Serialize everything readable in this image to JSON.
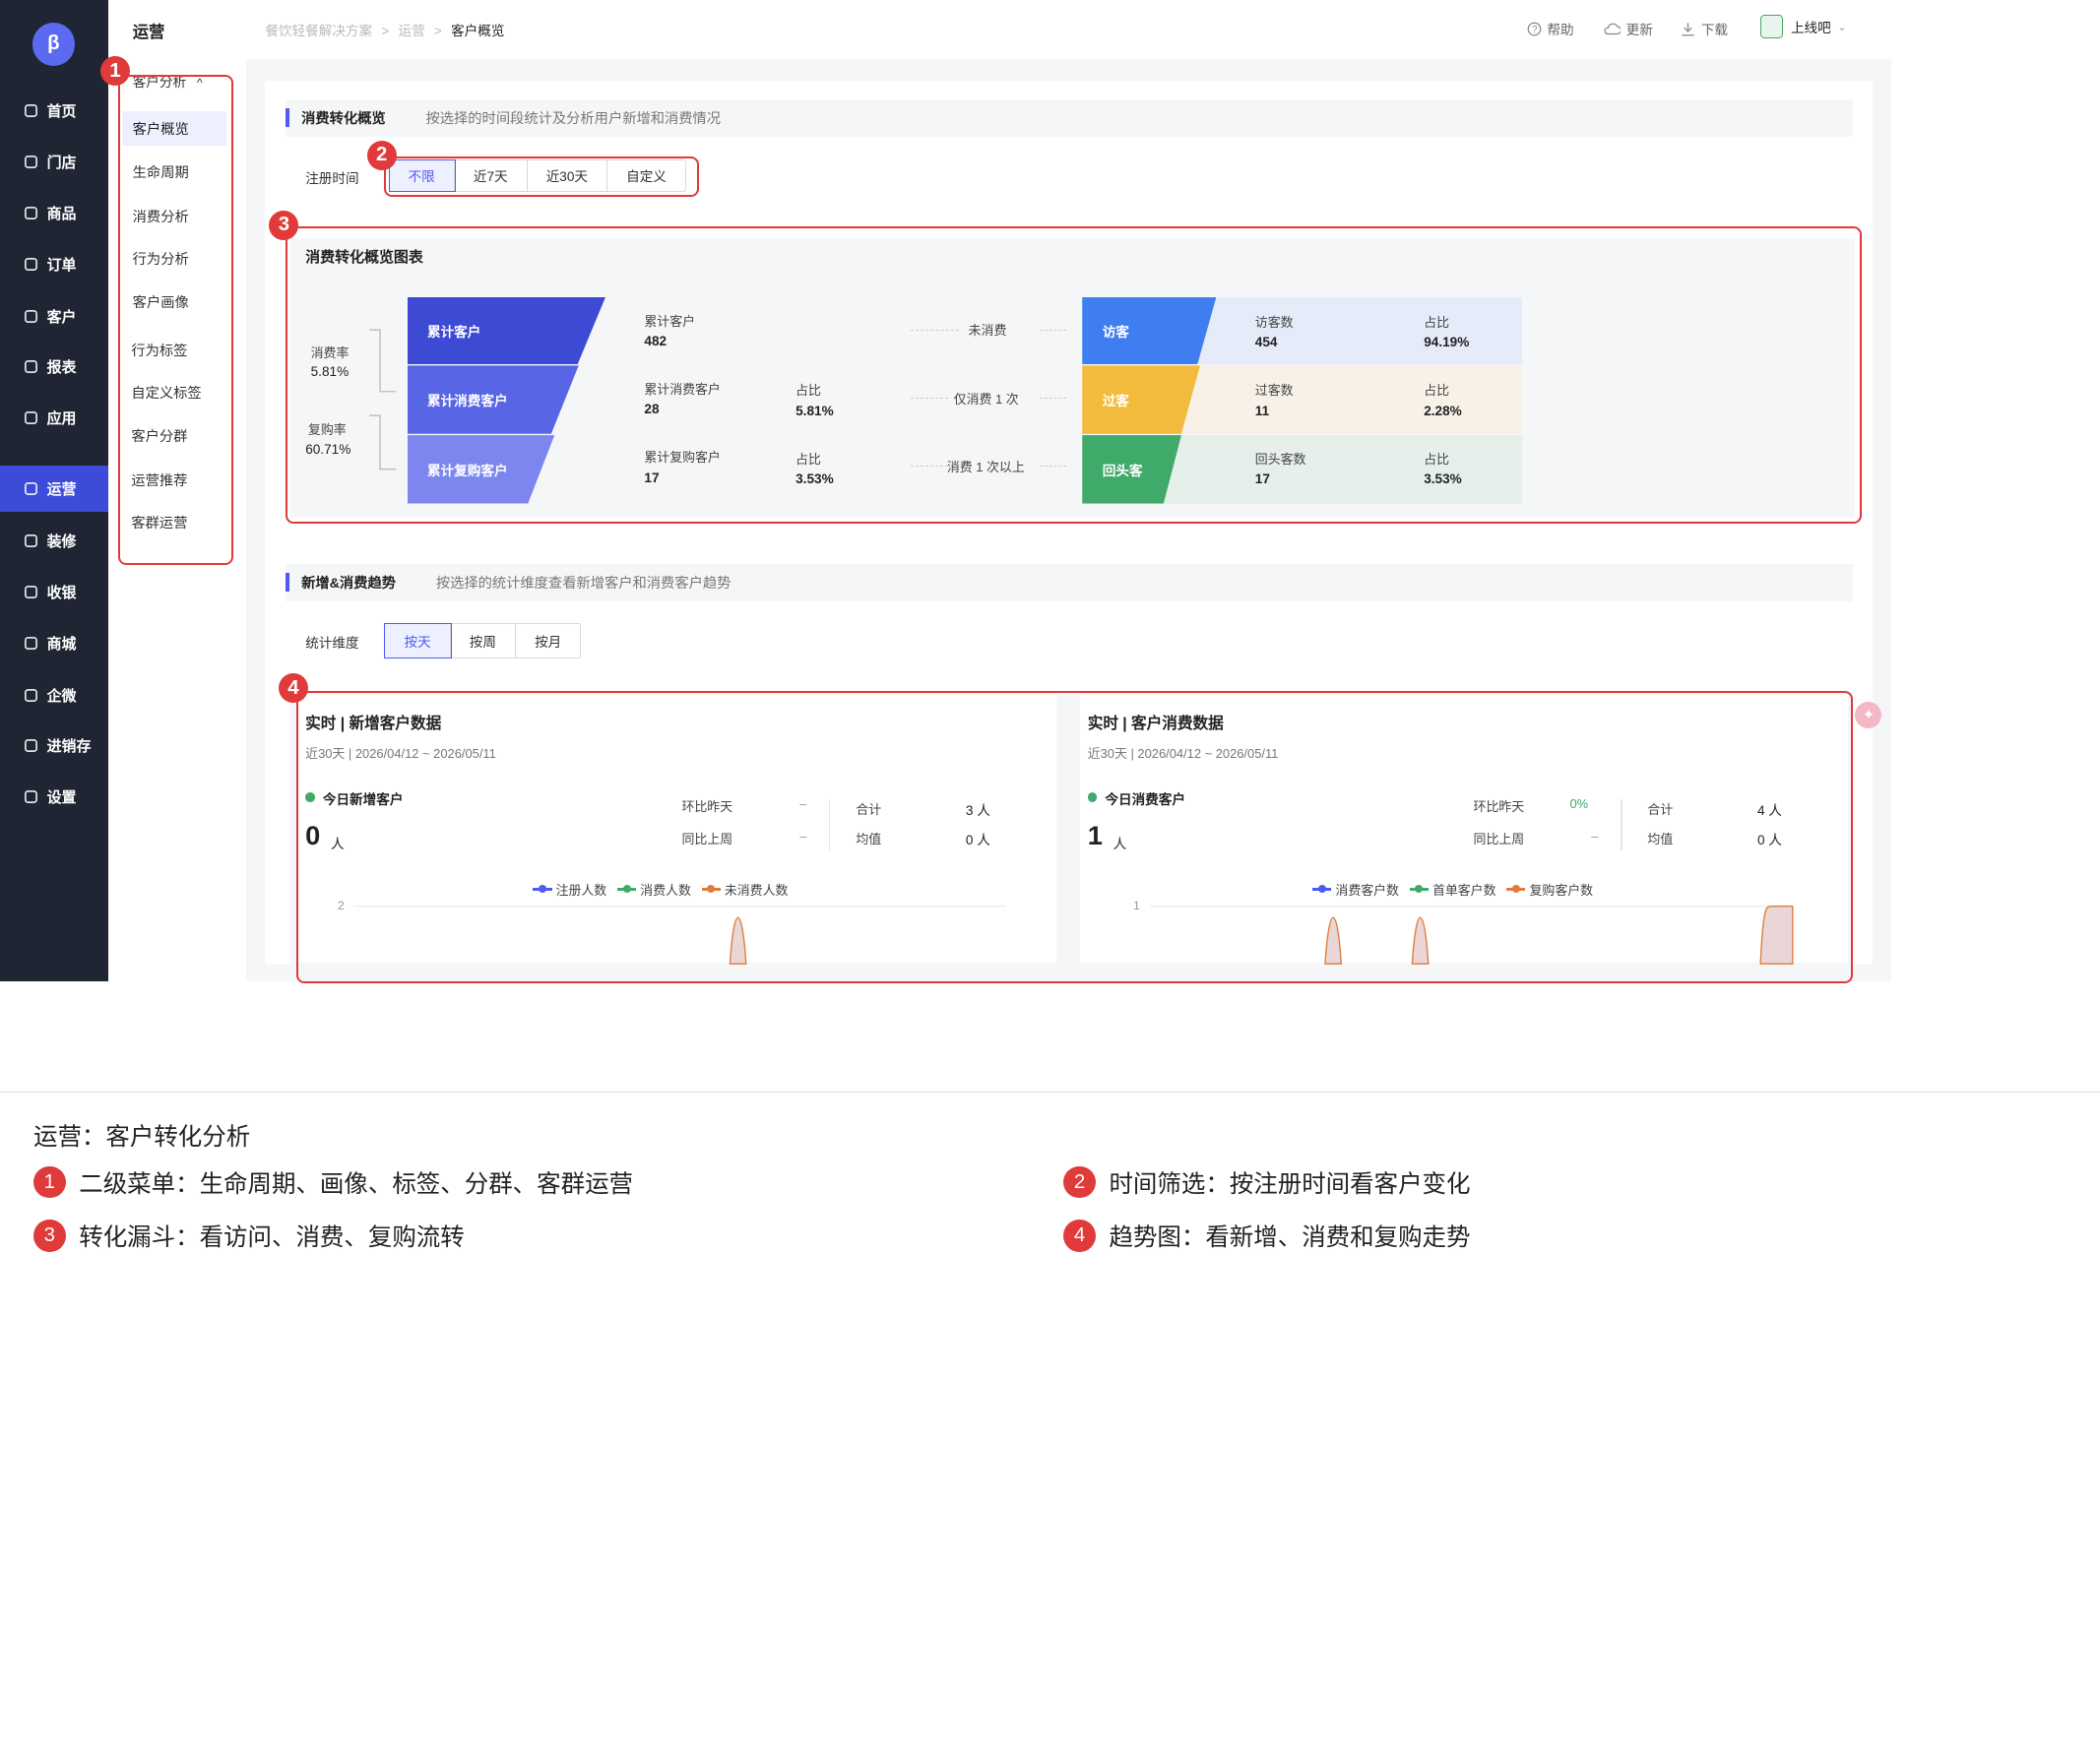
{
  "app": {
    "logo_text": "β"
  },
  "sidebar": {
    "items": [
      {
        "label": "首页",
        "icon": "home-icon"
      },
      {
        "label": "门店",
        "icon": "store-icon"
      },
      {
        "label": "商品",
        "icon": "bag-icon"
      },
      {
        "label": "订单",
        "icon": "order-icon"
      },
      {
        "label": "客户",
        "icon": "user-icon"
      },
      {
        "label": "报表",
        "icon": "report-icon"
      },
      {
        "label": "应用",
        "icon": "apps-icon"
      },
      {
        "label": "运营",
        "icon": "operation-icon",
        "active": true
      },
      {
        "label": "装修",
        "icon": "layers-icon"
      },
      {
        "label": "收银",
        "icon": "cashier-icon"
      },
      {
        "label": "商城",
        "icon": "mall-icon"
      },
      {
        "label": "企微",
        "icon": "chat-icon"
      },
      {
        "label": "进销存",
        "icon": "inventory-icon"
      },
      {
        "label": "设置",
        "icon": "settings-icon"
      }
    ]
  },
  "subnav": {
    "title": "运营",
    "group": "客户分析",
    "items": [
      "客户概览",
      "生命周期",
      "消费分析",
      "行为分析",
      "客户画像"
    ],
    "items2": [
      "行为标签",
      "自定义标签",
      "客户分群",
      "运营推荐",
      "客群运营"
    ]
  },
  "breadcrumb": {
    "root": "餐饮轻餐解决方案",
    "mid": "运营",
    "current": "客户概览",
    "sep": ">"
  },
  "top_actions": {
    "help": "帮助",
    "update": "更新",
    "download": "下载",
    "account": "上线吧"
  },
  "section1": {
    "title": "消费转化概览",
    "desc": "按选择的时间段统计及分析用户新增和消费情况",
    "filter_label": "注册时间",
    "filters": [
      "不限",
      "近7天",
      "近30天",
      "自定义"
    ]
  },
  "funnel": {
    "title": "消费转化概览图表",
    "rate1_label": "消费率",
    "rate1": "5.81%",
    "rate2_label": "复购率",
    "rate2": "60.71%",
    "blocks": [
      "累计客户",
      "累计消费客户",
      "累计复购客户"
    ],
    "rows": [
      {
        "k": "累计客户",
        "v": "482",
        "pk": "",
        "pv": "",
        "flow": "未消费",
        "type": "访客",
        "ck": "访客数",
        "cv": "454",
        "rk": "占比",
        "rv": "94.19%"
      },
      {
        "k": "累计消费客户",
        "v": "28",
        "pk": "占比",
        "pv": "5.81%",
        "flow": "仅消费 1 次",
        "type": "过客",
        "ck": "过客数",
        "cv": "11",
        "rk": "占比",
        "rv": "2.28%"
      },
      {
        "k": "累计复购客户",
        "v": "17",
        "pk": "占比",
        "pv": "3.53%",
        "flow": "消费 1 次以上",
        "type": "回头客",
        "ck": "回头客数",
        "cv": "17",
        "rk": "占比",
        "rv": "3.53%"
      }
    ]
  },
  "section2": {
    "title": "新增&消费趋势",
    "desc": "按选择的统计维度查看新增客户和消费客户趋势",
    "filter_label": "统计维度",
    "filters": [
      "按天",
      "按周",
      "按月"
    ]
  },
  "trend_left": {
    "title": "实时 | 新增客户数据",
    "range": "近30天 | 2026/04/12 ~ 2026/05/11",
    "metric": "今日新增客户",
    "value": "0",
    "unit": "人",
    "dod_label": "环比昨天",
    "dod": "–",
    "wow_label": "同比上周",
    "wow": "–",
    "sum_label": "合计",
    "sum": "3 人",
    "avg_label": "均值",
    "avg": "0 人",
    "legend": [
      "注册人数",
      "消费人数",
      "未消费人数"
    ],
    "ytick": "2"
  },
  "trend_right": {
    "title": "实时 | 客户消费数据",
    "range": "近30天 | 2026/04/12 ~ 2026/05/11",
    "metric": "今日消费客户",
    "value": "1",
    "unit": "人",
    "dod_label": "环比昨天",
    "dod": "0%",
    "wow_label": "同比上周",
    "wow": "–",
    "sum_label": "合计",
    "sum": "4 人",
    "avg_label": "均值",
    "avg": "0 人",
    "legend": [
      "消费客户数",
      "首单客户数",
      "复购客户数"
    ],
    "ytick": "1"
  },
  "annotations": {
    "b1": "1",
    "b2": "2",
    "b3": "3",
    "b4": "4"
  },
  "captions": {
    "title": "运营：客户转化分析",
    "c1": "二级菜单：生命周期、画像、标签、分群、客群运营",
    "c2": "时间筛选：按注册时间看客户变化",
    "c3": "转化漏斗：看访问、消费、复购流转",
    "c4": "趋势图：看新增、消费和复购走势"
  },
  "colors": {
    "accent": "#4d5bf0",
    "sidebar": "#1f2533",
    "annotation": "#e03a3a",
    "visitor": "#3f7ef0",
    "passer": "#f2bb3d",
    "returner": "#3faa6a"
  }
}
